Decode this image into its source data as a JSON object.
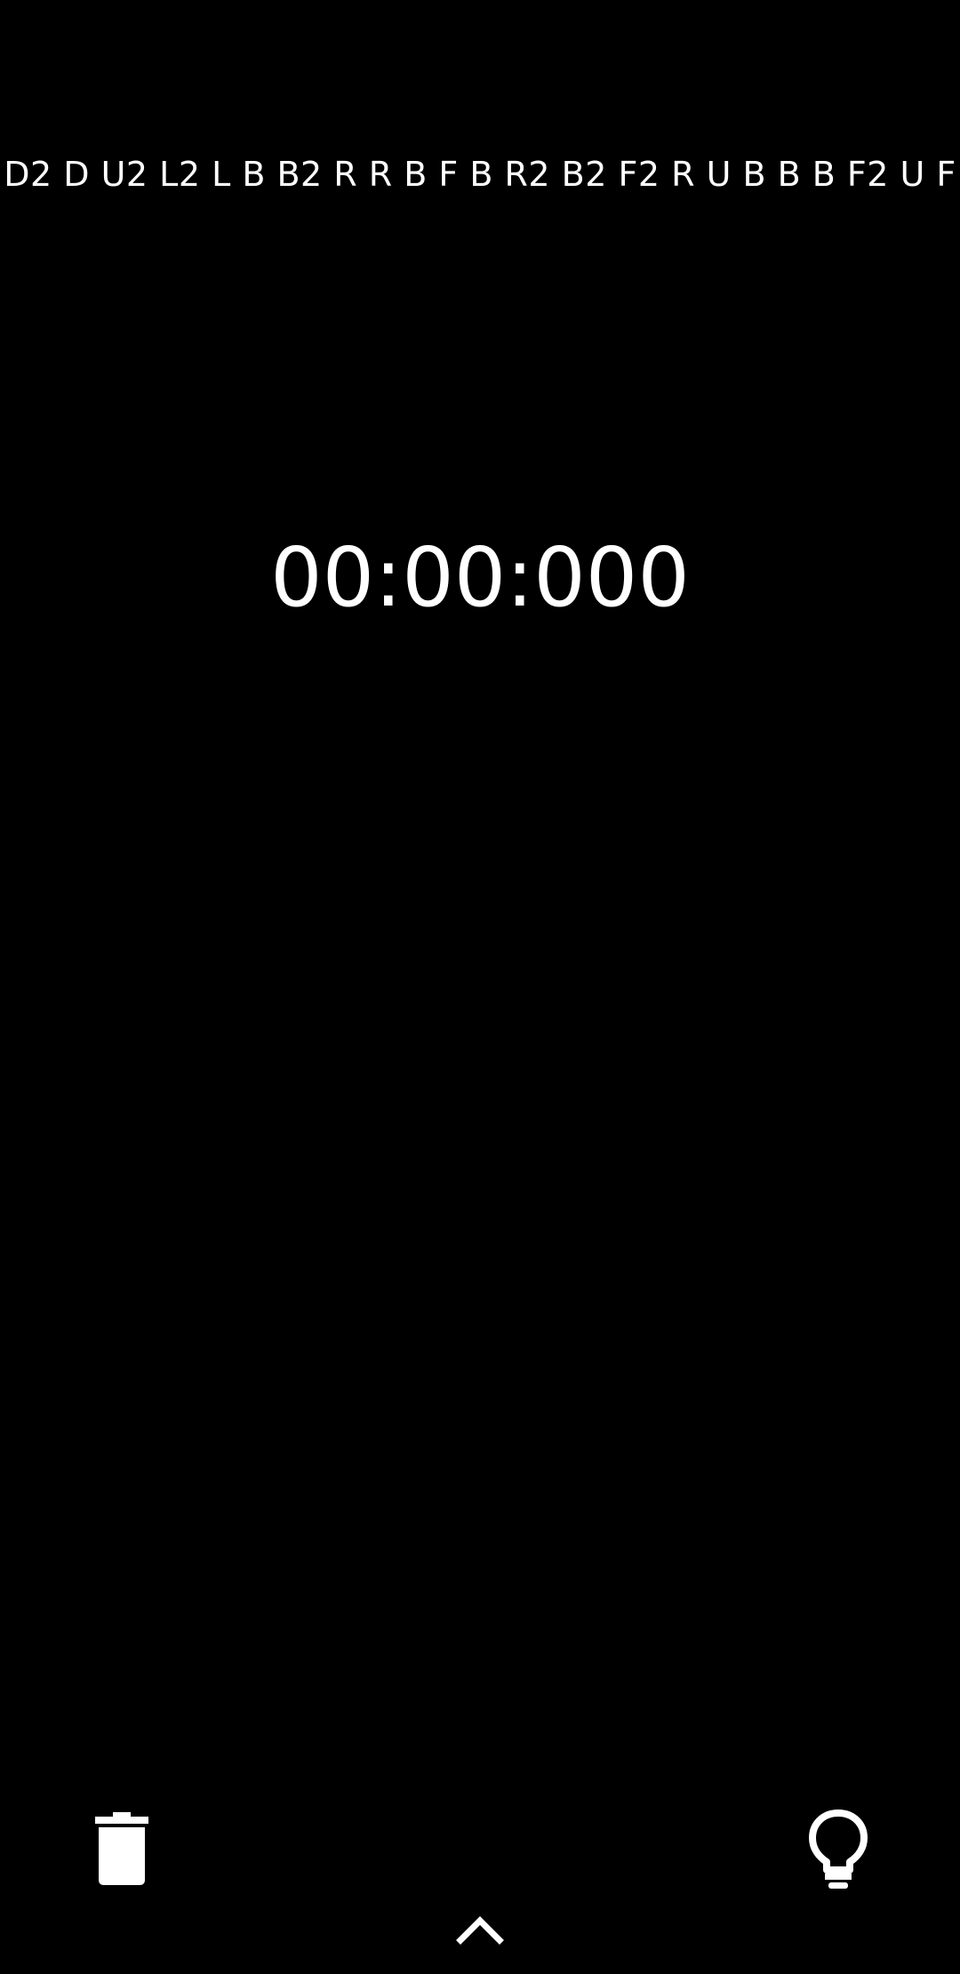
{
  "scramble": {
    "text": "D2 D U2 L2 L B B2 R R B F B R2 B2 F2 R U B B B F2 U F"
  },
  "timer": {
    "display": "00:00:000"
  },
  "bottom_bar": {
    "delete_icon": "trash-icon",
    "hint_icon": "lightbulb-icon",
    "expand_icon": "chevron-up-icon"
  },
  "colors": {
    "background": "#000000",
    "foreground": "#ffffff"
  }
}
